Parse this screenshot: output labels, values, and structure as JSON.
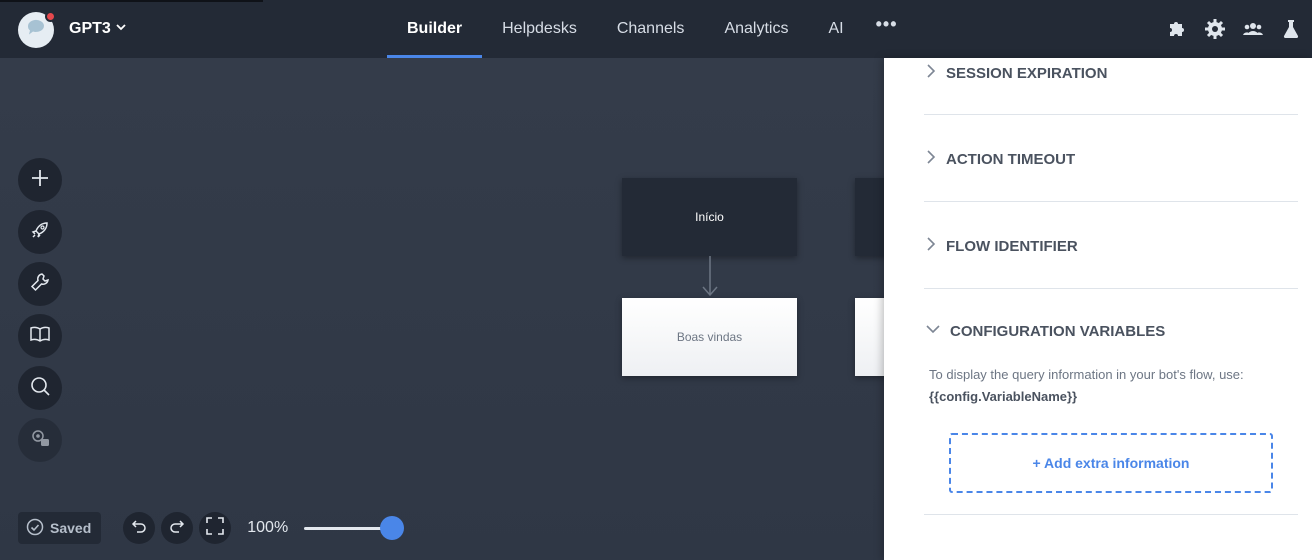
{
  "app": {
    "bot_name": "GPT3",
    "logo_icon": "chat-bubble-icon",
    "notification_color": "#e5484d"
  },
  "nav": {
    "items": [
      {
        "label": "Builder",
        "active": true
      },
      {
        "label": "Helpdesks",
        "active": false
      },
      {
        "label": "Channels",
        "active": false
      },
      {
        "label": "Analytics",
        "active": false
      },
      {
        "label": "AI",
        "active": false
      }
    ],
    "more_label": "•••",
    "accent_color": "#4a86e8"
  },
  "top_icons": [
    "puzzle-icon",
    "gear-icon",
    "users-icon",
    "flask-icon"
  ],
  "toolbar": {
    "tools": [
      "plus-icon",
      "rocket-icon",
      "wrench-icon",
      "book-icon",
      "search-icon",
      "settings-lock-icon"
    ]
  },
  "canvas": {
    "nodes": [
      {
        "label": "Início",
        "style": "dark"
      },
      {
        "label": "Boas vindas",
        "style": "light"
      },
      {
        "label": "",
        "style": "dark"
      },
      {
        "label": "",
        "style": "light"
      }
    ]
  },
  "status": {
    "saved_label": "Saved",
    "zoom_label": "100%",
    "zoom_level_percent": 100
  },
  "panel": {
    "sections": [
      {
        "title": "SESSION EXPIRATION",
        "expanded": false
      },
      {
        "title": "ACTION TIMEOUT",
        "expanded": false
      },
      {
        "title": "FLOW IDENTIFIER",
        "expanded": false
      },
      {
        "title": "CONFIGURATION VARIABLES",
        "expanded": true
      }
    ],
    "config_help_text": "To display the query information in your bot's flow, use:",
    "config_code": "{{config.VariableName}}",
    "add_button_label": "+ Add extra information"
  }
}
